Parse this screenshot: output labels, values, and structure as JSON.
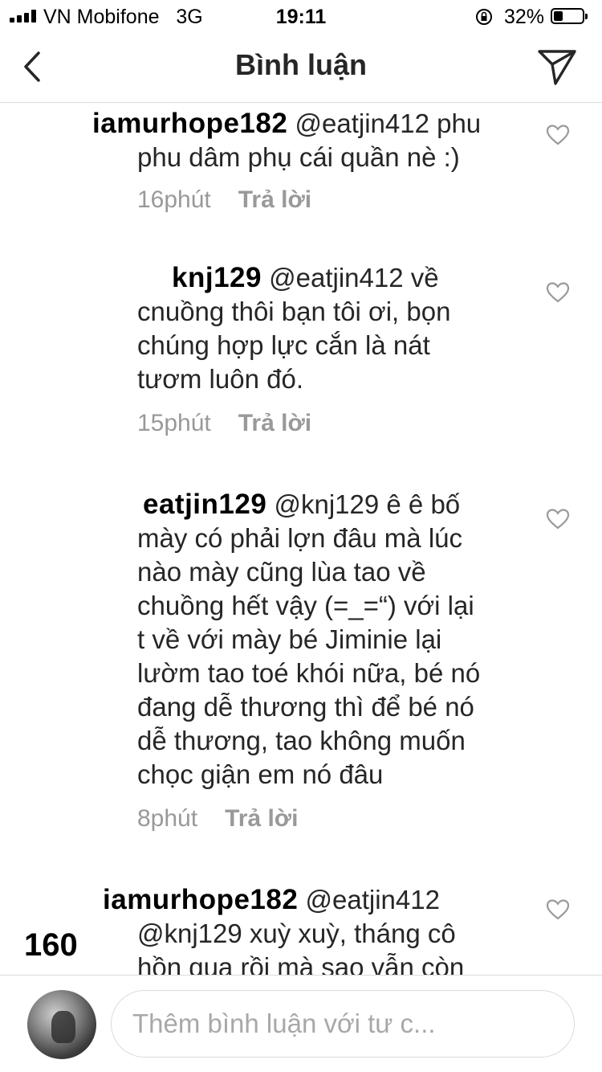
{
  "status": {
    "carrier": "VN Mobifone",
    "network": "3G",
    "time": "19:11",
    "battery_pct": "32%",
    "battery_level": 0.32
  },
  "nav": {
    "title": "Bình luận",
    "back_icon": "chevron-left-icon",
    "share_icon": "paper-plane-icon"
  },
  "comments": [
    {
      "username": "iamurhope182",
      "mention": "@eatjin412",
      "line1_rest": " phu",
      "lines": [
        "phu dâm phụ cái quần nè :)"
      ],
      "time": "16phút",
      "reply": "Trả lời"
    },
    {
      "username": "knj129",
      "mention": "@eatjin412",
      "line1_rest": " về",
      "lines": [
        "cnuồng thôi bạn tôi ơi, bọn",
        "chúng hợp lực cắn là nát",
        "tươm luôn đó."
      ],
      "time": "15phút",
      "reply": "Trả lời"
    },
    {
      "username": "eatjin129",
      "mention": "@knj129",
      "line1_rest": " ê ê bố",
      "lines": [
        "mày có phải lợn đâu mà lúc",
        "nào mày cũng lùa tao về",
        "chuồng hết vậy (=_=“) với lại",
        "t về với mày bé Jiminie lại",
        "lườm tao toé khói nữa, bé nó",
        "đang dễ thương thì để bé nó",
        "dễ thương, tao không muốn",
        "chọc giận em nó đâu"
      ],
      "time": "8phút",
      "reply": "Trả lời"
    },
    {
      "username": "iamurhope182",
      "mention": "@eatjin412",
      "line1_rest": "",
      "lines": [
        "@knj129 xuỳ xuỳ, tháng cô",
        "hồn qua rồi mà sao vẫn còn"
      ],
      "time": "",
      "reply": ""
    }
  ],
  "side_number": "160",
  "composer": {
    "placeholder": "Thêm bình luận với tư c..."
  }
}
